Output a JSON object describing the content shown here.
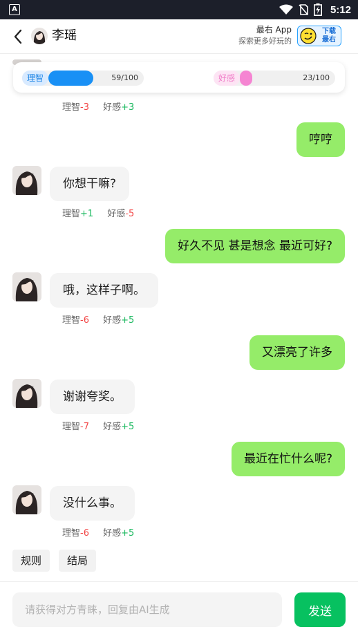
{
  "status_bar": {
    "app_icon_letter": "A",
    "time": "5:12",
    "icons": [
      "wifi-icon",
      "no-sim-icon",
      "battery-charging-icon"
    ]
  },
  "header": {
    "name": "李瑶",
    "promo_title": "最右 App",
    "promo_subtitle": "探索更多好玩的",
    "download_label_1": "下载",
    "download_label_2": "最右"
  },
  "stats": {
    "sanity_label": "理智",
    "sanity_value": 59,
    "sanity_max": 100,
    "sanity_text": "59/100",
    "favor_label": "好感",
    "favor_value": 23,
    "favor_max": 100,
    "favor_text": "23/100"
  },
  "messages": [
    {
      "side": "left",
      "deltas": {
        "sanity_label": "理智",
        "sanity": "-3",
        "favor_label": "好感",
        "favor": "+3"
      }
    },
    {
      "side": "right",
      "text": "哼哼"
    },
    {
      "side": "left",
      "text": "你想干嘛?",
      "deltas": {
        "sanity_label": "理智",
        "sanity": "+1",
        "favor_label": "好感",
        "favor": "-5"
      }
    },
    {
      "side": "right",
      "text": "好久不见 甚是想念 最近可好?"
    },
    {
      "side": "left",
      "text": "哦，这样子啊。",
      "deltas": {
        "sanity_label": "理智",
        "sanity": "-6",
        "favor_label": "好感",
        "favor": "+5"
      }
    },
    {
      "side": "right",
      "text": "又漂亮了许多"
    },
    {
      "side": "left",
      "text": "谢谢夸奖。",
      "deltas": {
        "sanity_label": "理智",
        "sanity": "-7",
        "favor_label": "好感",
        "favor": "+5"
      }
    },
    {
      "side": "right",
      "text": "最近在忙什么呢?"
    },
    {
      "side": "left",
      "text": "没什么事。",
      "deltas": {
        "sanity_label": "理智",
        "sanity": "-6",
        "favor_label": "好感",
        "favor": "+5"
      }
    }
  ],
  "chips": {
    "rules": "规则",
    "ending": "结局"
  },
  "composer": {
    "placeholder": "请获得对方青睐，回复由AI生成",
    "send_label": "发送"
  },
  "colors": {
    "bubble_right": "#95ec69",
    "bubble_left": "#f4f4f4",
    "send_button": "#07c160",
    "sanity_fill": "#1990f5",
    "favor_fill": "#f585d2",
    "negative": "#f24545",
    "positive": "#19b85e"
  }
}
